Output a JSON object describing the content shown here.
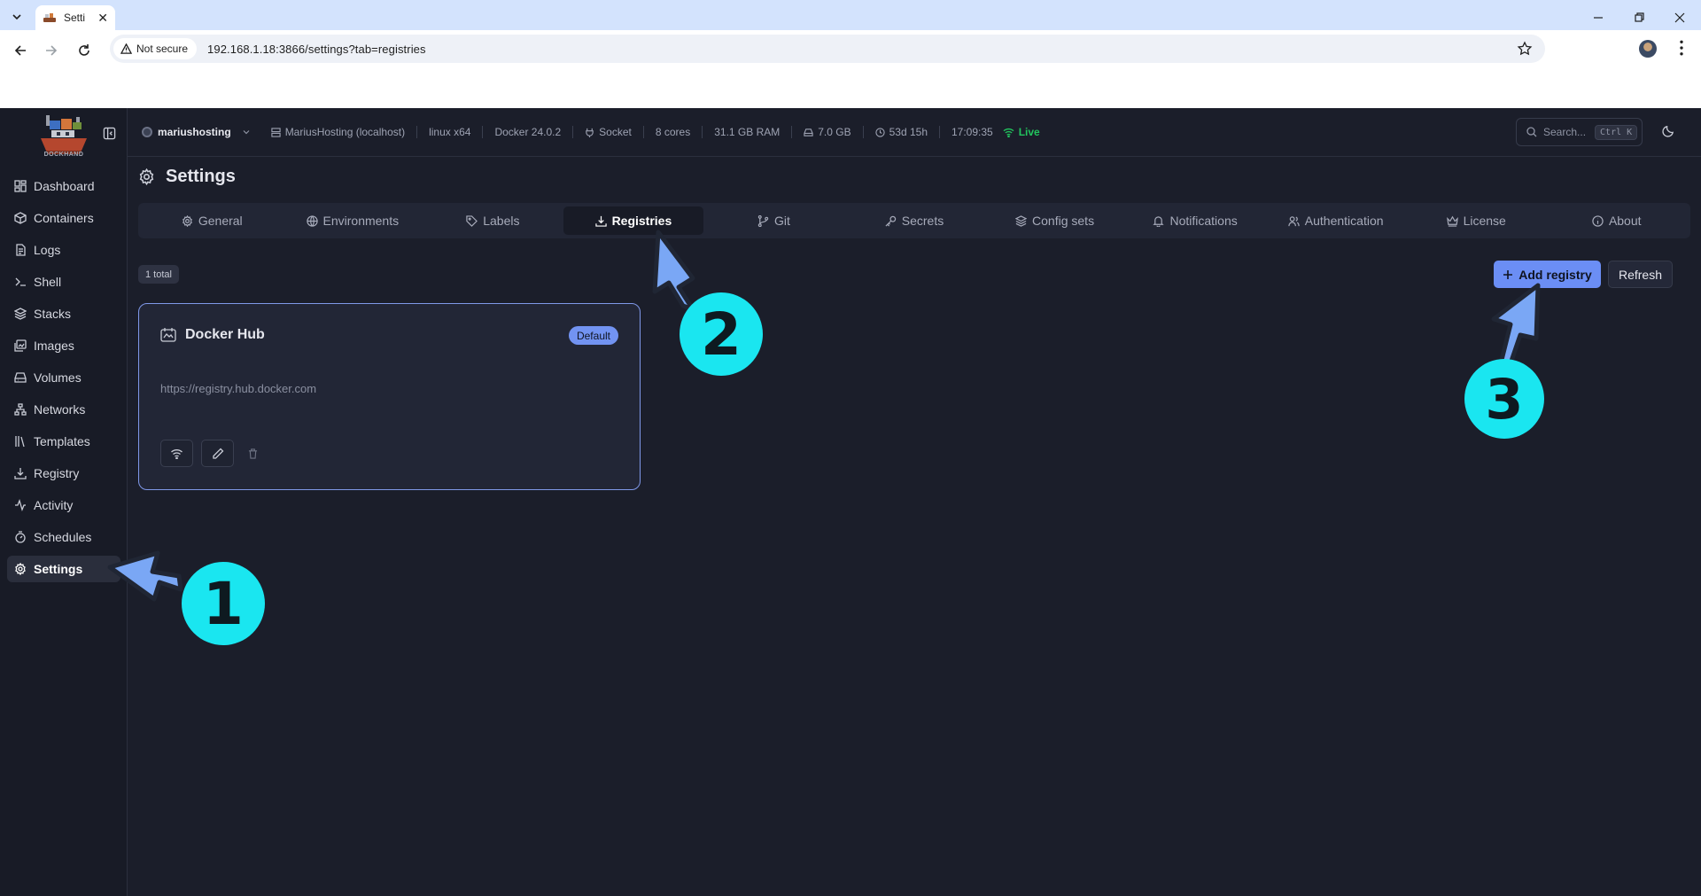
{
  "browser": {
    "tab_title": "Setti",
    "security_label": "Not secure",
    "url": "192.168.1.18:3866/settings?tab=registries"
  },
  "sidebar": {
    "logo_text": "DOCKHAND",
    "items": [
      {
        "label": "Dashboard",
        "icon": "dashboard-icon"
      },
      {
        "label": "Containers",
        "icon": "box-icon"
      },
      {
        "label": "Logs",
        "icon": "logs-icon"
      },
      {
        "label": "Shell",
        "icon": "terminal-icon"
      },
      {
        "label": "Stacks",
        "icon": "layers-icon"
      },
      {
        "label": "Images",
        "icon": "images-icon"
      },
      {
        "label": "Volumes",
        "icon": "drive-icon"
      },
      {
        "label": "Networks",
        "icon": "network-icon"
      },
      {
        "label": "Templates",
        "icon": "library-icon"
      },
      {
        "label": "Registry",
        "icon": "download-icon"
      },
      {
        "label": "Activity",
        "icon": "activity-icon"
      },
      {
        "label": "Schedules",
        "icon": "timer-icon"
      },
      {
        "label": "Settings",
        "icon": "gear-icon",
        "active": true
      }
    ]
  },
  "topbar": {
    "environment": "mariushosting",
    "host": "MariusHosting (localhost)",
    "platform": "linux x64",
    "docker_version": "Docker 24.0.2",
    "connection": "Socket",
    "cores": "8 cores",
    "ram": "31.1 GB RAM",
    "disk": "7.0 GB",
    "uptime": "53d 15h",
    "time": "17:09:35",
    "status": "Live",
    "search_placeholder": "Search...",
    "search_shortcut": "Ctrl K",
    "status_color": "#22c55e"
  },
  "page": {
    "title": "Settings",
    "tabs": [
      {
        "label": "General",
        "icon": "gear-icon"
      },
      {
        "label": "Environments",
        "icon": "globe-icon"
      },
      {
        "label": "Labels",
        "icon": "tag-icon"
      },
      {
        "label": "Registries",
        "icon": "download-icon",
        "active": true
      },
      {
        "label": "Git",
        "icon": "git-branch-icon"
      },
      {
        "label": "Secrets",
        "icon": "key-icon"
      },
      {
        "label": "Config sets",
        "icon": "layers-icon"
      },
      {
        "label": "Notifications",
        "icon": "bell-icon"
      },
      {
        "label": "Authentication",
        "icon": "users-icon"
      },
      {
        "label": "License",
        "icon": "crown-icon"
      },
      {
        "label": "About",
        "icon": "info-icon"
      }
    ],
    "total_label": "1 total",
    "add_button": "Add registry",
    "refresh_button": "Refresh",
    "accent_color": "#6b8ef5"
  },
  "registries": [
    {
      "name": "Docker Hub",
      "badge": "Default",
      "url": "https://registry.hub.docker.com"
    }
  ],
  "annotations": {
    "steps": [
      "1",
      "2",
      "3"
    ],
    "circle_color": "#1ae6f0",
    "arrow_color": "#7aa7f5"
  }
}
